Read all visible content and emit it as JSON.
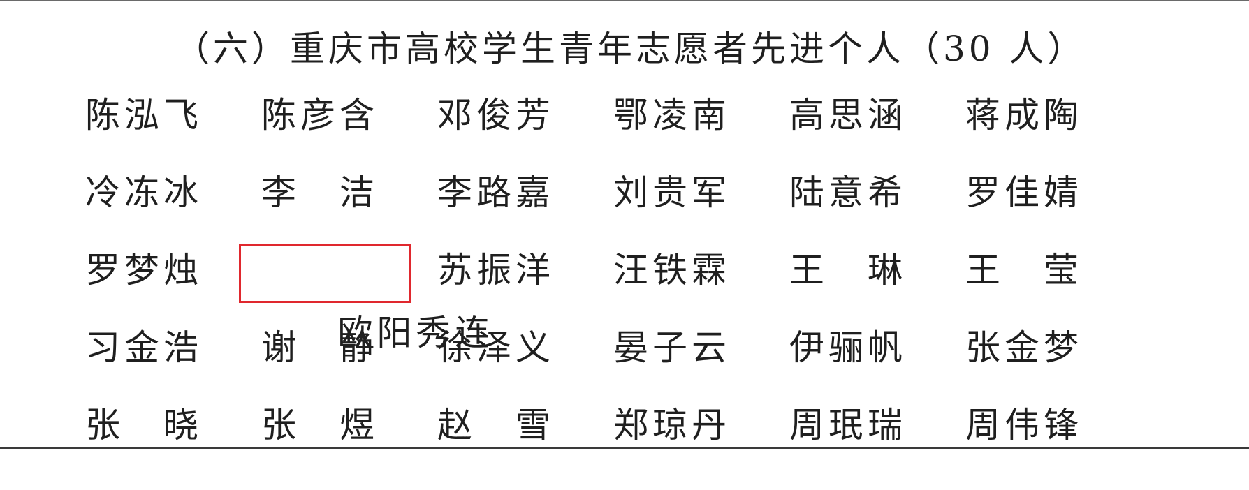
{
  "heading": "（六）重庆市高校学生青年志愿者先进个人（30 人）",
  "highlight_color": "#e0282e",
  "rows": [
    [
      "陈泓飞",
      "陈彦含",
      "邓俊芳",
      "鄂凌南",
      "高思涵",
      "蒋成陶"
    ],
    [
      "冷冻冰",
      "李　洁",
      "李路嘉",
      "刘贵军",
      "陆意希",
      "罗佳婧"
    ],
    [
      "罗梦烛",
      "欧阳秀连",
      "苏振洋",
      "汪铁霖",
      "王　琳",
      "王　莹"
    ],
    [
      "习金浩",
      "谢　静",
      "徐泽义",
      "晏子云",
      "伊骊帆",
      "张金梦"
    ],
    [
      "张　晓",
      "张　煜",
      "赵　雪",
      "郑琼丹",
      "周珉瑞",
      "周伟锋"
    ]
  ],
  "highlighted_name": "欧阳秀连"
}
